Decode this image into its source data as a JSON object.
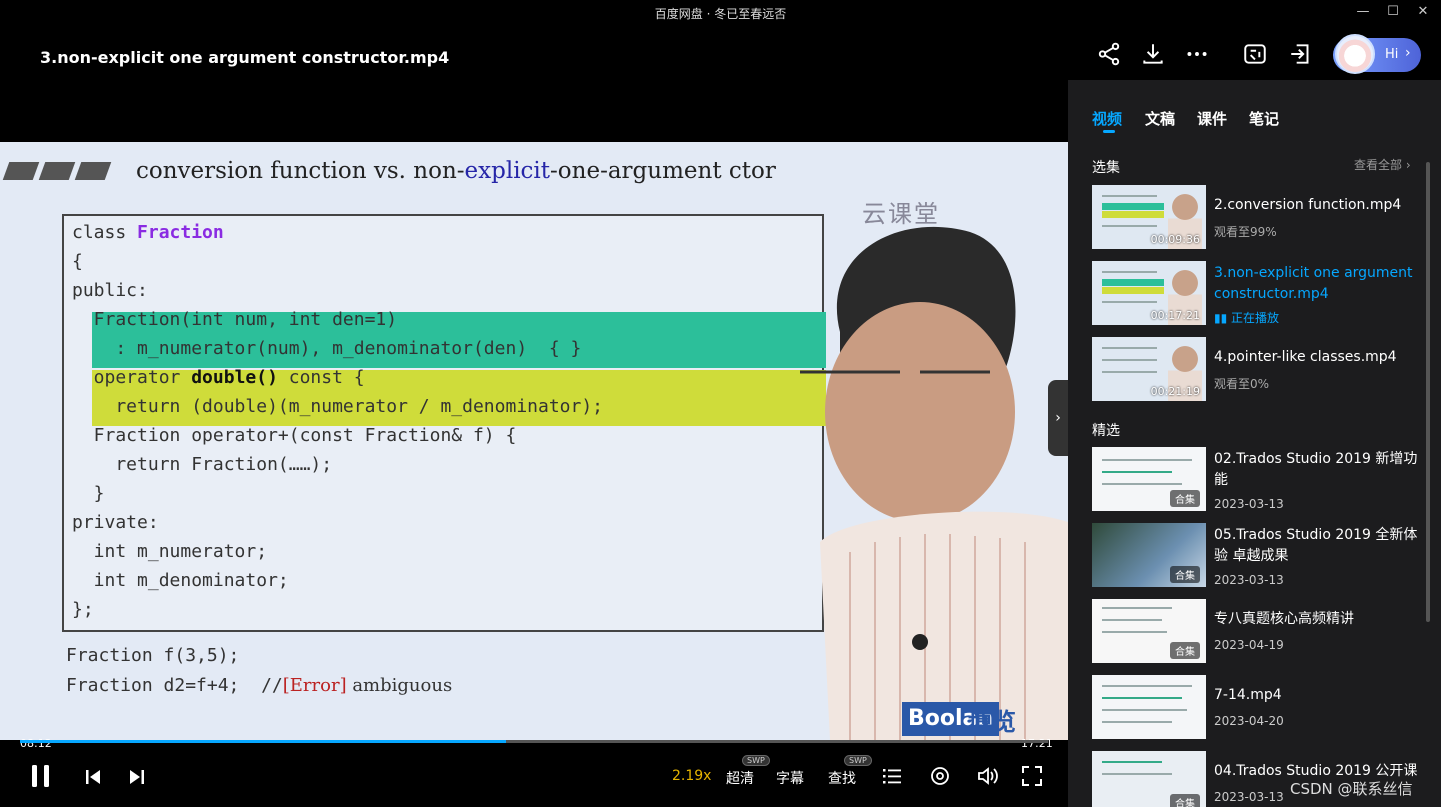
{
  "app": {
    "title": "百度网盘 · 冬已至春远否"
  },
  "window": {
    "minimize": "—",
    "maximize": "☐",
    "close": "✕"
  },
  "header": {
    "video_title": "3.non-explicit one argument constructor.mp4",
    "hi_label": "Hi"
  },
  "header_icons": [
    "share-icon",
    "download-icon",
    "more-icon",
    "screen-capture-icon",
    "pip-icon"
  ],
  "slide": {
    "title_prefix": "conversion function vs. non-",
    "title_keyword": "explicit",
    "title_suffix": "-one-argument ctor",
    "watermark": "云课堂",
    "code": {
      "l1a": "class ",
      "l1b": "Fraction",
      "l2": "{",
      "l3": "public:",
      "l4": "  Fraction(int num, int den=1)",
      "l5": "    : m_numerator(num), m_denominator(den)  { }",
      "l6a": "  operator ",
      "l6b": "double()",
      "l6c": " const {",
      "l7": "    return (double)(m_numerator / m_denominator);",
      "l8": "  Fraction operator+(const Fraction& f) {",
      "l9": "    return Fraction(……);",
      "l10": "  }",
      "l11": "private:",
      "l12": "  int m_numerator;",
      "l13": "  int m_denominator;",
      "l14": "};"
    },
    "bottom1": "Fraction f(3,5);",
    "bottom2": "Fraction d2=f+4;  //",
    "bottom2_err": "[Error]",
    "bottom2_tail": " ambiguous",
    "brand": "Boolan",
    "brand_cn": "博览"
  },
  "player": {
    "current_time": "08:12",
    "total_time": "17:21",
    "progress": 0.473,
    "speed": "2.19x",
    "quality": "超清",
    "subtitle": "字幕",
    "search": "查找",
    "swp": "SWP"
  },
  "sidebar": {
    "tabs": [
      "视频",
      "文稿",
      "课件",
      "笔记"
    ],
    "series_label": "选集",
    "view_all": "查看全部 ›",
    "featured_label": "精选",
    "series": [
      {
        "title": "2.conversion function.mp4",
        "duration": "00:09:36",
        "status": "观看至99%"
      },
      {
        "title": "3.non-explicit one argument constructor.mp4",
        "duration": "00:17:21",
        "status": "正在播放"
      },
      {
        "title": "4.pointer-like classes.mp4",
        "duration": "00:21:19",
        "status": "观看至0%"
      }
    ],
    "featured": [
      {
        "title": "02.Trados Studio 2019 新增功能",
        "date": "2023-03-13",
        "badge": "合集"
      },
      {
        "title": "05.Trados Studio 2019 全新体验 卓越成果",
        "date": "2023-03-13",
        "badge": "合集"
      },
      {
        "title": "专八真题核心高频精讲",
        "date": "2023-04-19",
        "badge": "合集"
      },
      {
        "title": "7-14.mp4",
        "date": "2023-04-20",
        "badge": ""
      },
      {
        "title": "04.Trados Studio 2019 公开课",
        "date": "2023-03-13",
        "badge": "合集"
      }
    ]
  },
  "watermark": "CSDN @联系丝信",
  "colors": {
    "accent": "#06a7ff",
    "speed": "#e6b400",
    "sidebar_bg": "#1c1c1e"
  }
}
